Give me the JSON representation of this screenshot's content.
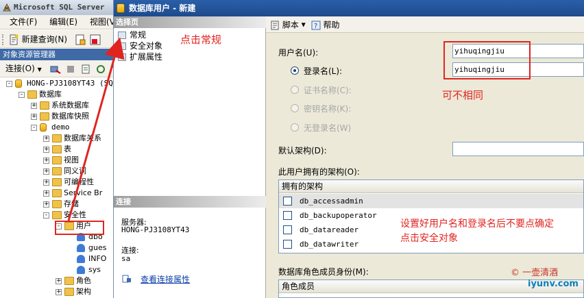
{
  "left_window": {
    "title": "Microsoft SQL Server",
    "menu": [
      "文件(F)",
      "编辑(E)",
      "视图(V)"
    ],
    "toolbar_new_query": "新建查询(N)",
    "object_explorer_title": "对象资源管理器",
    "connect_label": "连接(O)",
    "tree": [
      {
        "label": "HONG-PJ3108YT43 (SQ",
        "level": 0,
        "expander": "-"
      },
      {
        "label": "数据库",
        "level": 1,
        "expander": "-"
      },
      {
        "label": "系统数据库",
        "level": 2,
        "expander": "+"
      },
      {
        "label": "数据库快照",
        "level": 2,
        "expander": "+"
      },
      {
        "label": "demo",
        "level": 2,
        "expander": "-"
      },
      {
        "label": "数据库关系",
        "level": 3,
        "expander": "+"
      },
      {
        "label": "表",
        "level": 3,
        "expander": "+"
      },
      {
        "label": "视图",
        "level": 3,
        "expander": "+"
      },
      {
        "label": "同义词",
        "level": 3,
        "expander": "+"
      },
      {
        "label": "可编程性",
        "level": 3,
        "expander": "+"
      },
      {
        "label": "Service Br",
        "level": 3,
        "expander": "+"
      },
      {
        "label": "存储",
        "level": 3,
        "expander": "+"
      },
      {
        "label": "安全性",
        "level": 3,
        "expander": "-"
      },
      {
        "label": "用户",
        "level": 4,
        "expander": "-"
      },
      {
        "label": "dbo",
        "level": 5,
        "expander": ""
      },
      {
        "label": "gues",
        "level": 5,
        "expander": ""
      },
      {
        "label": "INFO",
        "level": 5,
        "expander": ""
      },
      {
        "label": "sys",
        "level": 5,
        "expander": ""
      },
      {
        "label": "角色",
        "level": 4,
        "expander": "+"
      },
      {
        "label": "架构",
        "level": 4,
        "expander": "+"
      }
    ]
  },
  "dialog": {
    "title": "数据库用户 - 新建",
    "select_page_header": "选择页",
    "pages": [
      "常规",
      "安全对象",
      "扩展属性"
    ],
    "connection_header": "连接",
    "server_label": "服务器:",
    "server_value": "HONG-PJ3108YT43",
    "connection_label": "连接:",
    "connection_value": "sa",
    "view_connection_link": "查看连接属性",
    "toolbar_script": "脚本",
    "toolbar_help": "帮助",
    "username_label": "用户名(U):",
    "username_value": "yihuqingjiu",
    "login_radio_label": "登录名(L):",
    "login_value": "yihuqingjiu",
    "cert_label": "证书名称(C):",
    "key_label": "密钥名称(K):",
    "no_login_label": "无登录名(W)",
    "default_schema_label": "默认架构(D):",
    "owned_schemas_label": "此用户拥有的架构(O):",
    "owned_schemas_header": "拥有的架构",
    "owned_schemas": [
      "db_accessadmin",
      "db_backupoperator",
      "db_datareader",
      "db_datawriter"
    ],
    "role_members_label": "数据库角色成员身份(M):",
    "role_members_header": "角色成员"
  },
  "annotations": {
    "click_general": "点击常规",
    "can_differ": "可不相同",
    "instruction_line1": "设置好用户名和登录名后不要点确定",
    "instruction_line2": "点击安全对象",
    "color": "#e0241f"
  },
  "watermark": {
    "line1": "© 一壶清酒",
    "line2": "iyunv.com"
  }
}
